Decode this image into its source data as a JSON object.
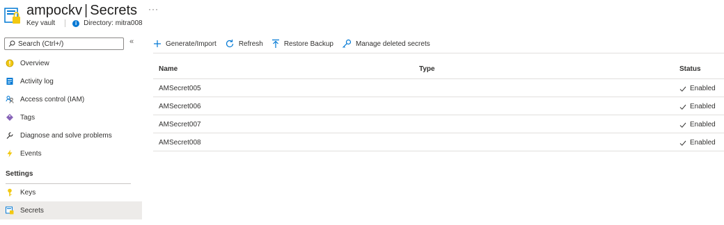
{
  "header": {
    "resource_name": "ampockv",
    "separator": "|",
    "page_name": "Secrets",
    "more": "···",
    "resource_type": "Key vault",
    "directory": "Directory: mitra008"
  },
  "sidebar": {
    "search_placeholder": "Search (Ctrl+/)",
    "collapse": "«",
    "items": [
      {
        "label": "Overview",
        "icon": "overview-icon"
      },
      {
        "label": "Activity log",
        "icon": "activity-log-icon"
      },
      {
        "label": "Access control (IAM)",
        "icon": "iam-icon"
      },
      {
        "label": "Tags",
        "icon": "tag-icon"
      },
      {
        "label": "Diagnose and solve problems",
        "icon": "wrench-icon"
      },
      {
        "label": "Events",
        "icon": "lightning-icon"
      }
    ],
    "settings_label": "Settings",
    "settings_items": [
      {
        "label": "Keys",
        "icon": "key-icon"
      },
      {
        "label": "Secrets",
        "icon": "secrets-icon",
        "active": true
      }
    ]
  },
  "toolbar": {
    "generate": "Generate/Import",
    "refresh": "Refresh",
    "restore": "Restore Backup",
    "manage": "Manage deleted secrets"
  },
  "table": {
    "columns": [
      "Name",
      "Type",
      "Status"
    ],
    "rows": [
      {
        "name": "AMSecret005",
        "type": "",
        "status": "Enabled"
      },
      {
        "name": "AMSecret006",
        "type": "",
        "status": "Enabled"
      },
      {
        "name": "AMSecret007",
        "type": "",
        "status": "Enabled"
      },
      {
        "name": "AMSecret008",
        "type": "",
        "status": "Enabled"
      }
    ]
  },
  "colors": {
    "accent": "#0078d4",
    "active_nav": "#edebe9",
    "key_yellow": "#f2c811"
  }
}
